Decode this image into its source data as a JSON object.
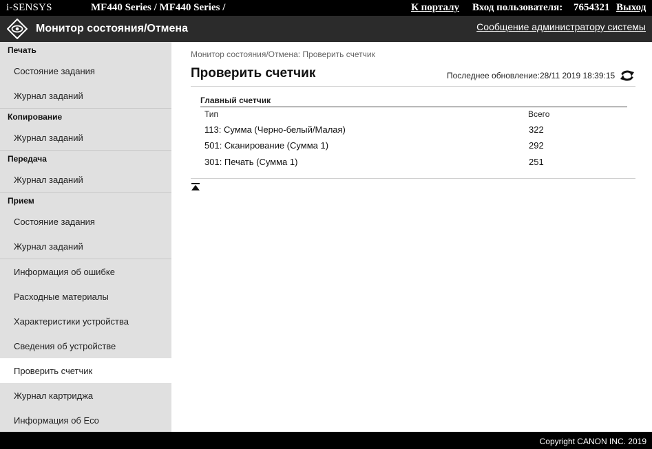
{
  "topbar": {
    "brand": "i-SENSYS",
    "model": "MF440 Series / MF440 Series /",
    "portal_link": "К порталу",
    "login_label": "Вход пользователя:",
    "user_id": "7654321",
    "logout_link": "Выход"
  },
  "header": {
    "title": "Монитор состояния/Отмена",
    "admin_link": "Сообщение администратору системы",
    "logo_icon": "eye-diamond-icon"
  },
  "sidebar": {
    "sections": [
      {
        "title": "Печать",
        "items": [
          "Состояние задания",
          "Журнал заданий"
        ]
      },
      {
        "title": "Копирование",
        "items": [
          "Журнал заданий"
        ]
      },
      {
        "title": "Передача",
        "items": [
          "Журнал заданий"
        ]
      },
      {
        "title": "Прием",
        "items": [
          "Состояние задания",
          "Журнал заданий"
        ]
      }
    ],
    "extra_items": [
      "Информация об ошибке",
      "Расходные материалы",
      "Характеристики устройства",
      "Сведения об устройстве",
      "Проверить счетчик",
      "Журнал картриджа",
      "Информация об Eco"
    ],
    "active_item": "Проверить счетчик"
  },
  "main": {
    "breadcrumb": "Монитор состояния/Отмена: Проверить счетчик",
    "title": "Проверить счетчик",
    "last_update": "Последнее обновление:28/11 2019 18:39:15",
    "refresh_icon": "refresh-icon",
    "counter": {
      "title": "Главный счетчик",
      "col_type": "Тип",
      "col_total": "Всего",
      "rows": [
        {
          "type": "113: Сумма (Черно-белый/Малая)",
          "total": "322"
        },
        {
          "type": "501: Сканирование (Сумма 1)",
          "total": "292"
        },
        {
          "type": "301: Печать (Сумма 1)",
          "total": "251"
        }
      ]
    },
    "back_to_top_icon": "back-to-top-icon"
  },
  "footer": {
    "copyright": "Copyright CANON INC. 2019"
  }
}
